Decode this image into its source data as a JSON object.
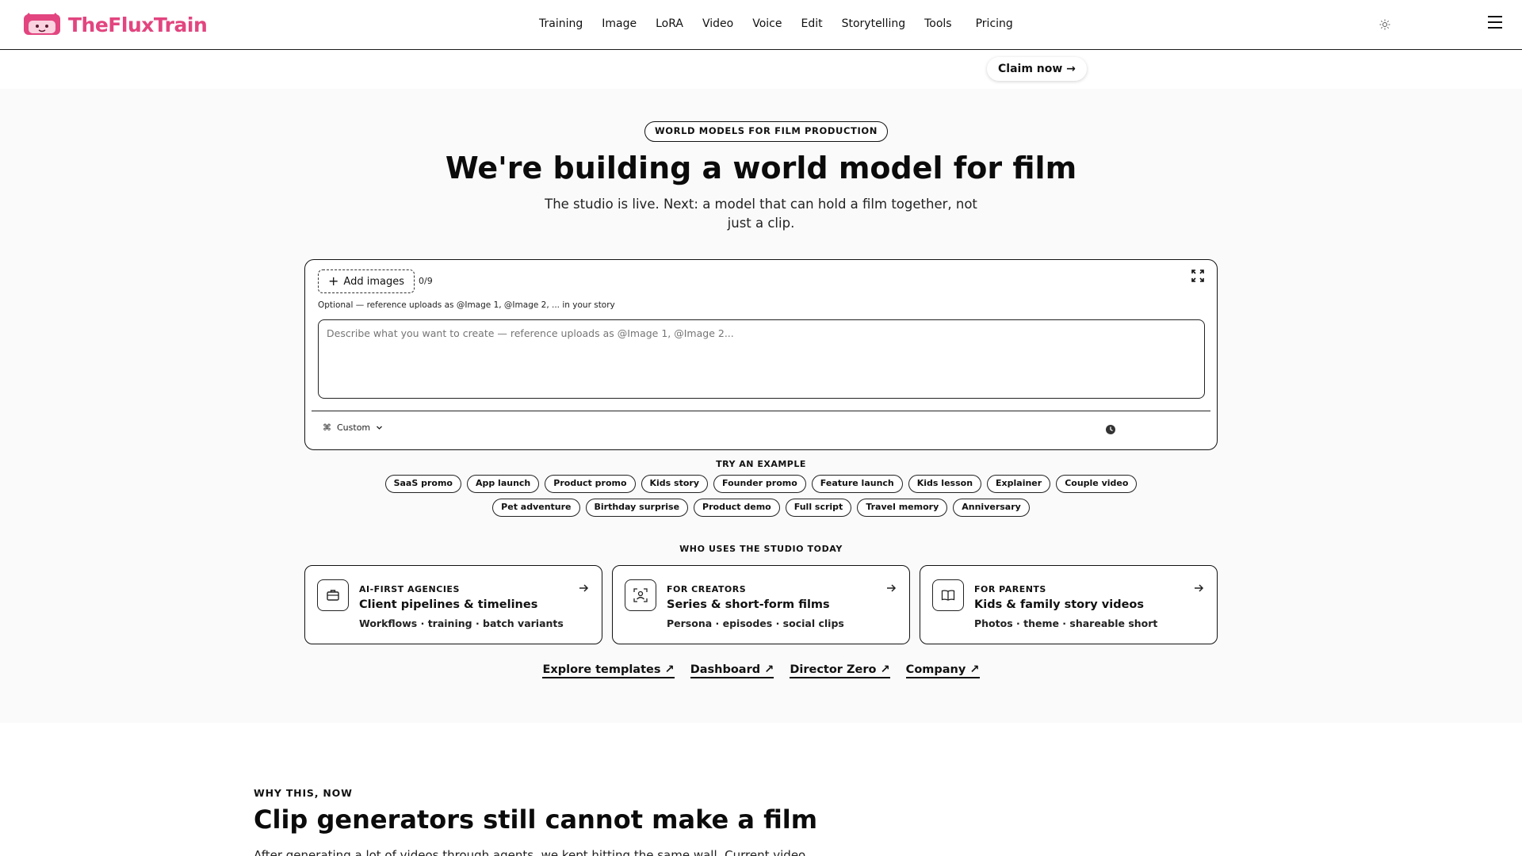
{
  "header": {
    "brand": "TheFluxTrain",
    "nav": [
      "Training",
      "Image",
      "LoRA",
      "Video",
      "Voice",
      "Edit",
      "Storytelling",
      "Tools",
      "Pricing"
    ],
    "theme_icon": "sun-icon",
    "menu_icon": "hamburger-icon"
  },
  "banner": {
    "claim_label": "Claim now →"
  },
  "hero": {
    "eyebrow": "WORLD MODELS FOR FILM PRODUCTION",
    "title": "We're building a world model for film",
    "subtitle": "The studio is live. Next: a model that can hold a film together, not just a clip."
  },
  "composer": {
    "add_images_label": "Add images",
    "image_count": "0/9",
    "hint": "Optional — reference uploads as @Image 1, @Image 2, ... in your story",
    "prompt_placeholder": "Describe what you want to create — reference uploads as @Image 1, @Image 2...",
    "prompt_value": "",
    "mode_label": "Custom",
    "expand_icon": "expand-icon",
    "history_icon": "clock-icon"
  },
  "examples": {
    "label": "TRY AN EXAMPLE",
    "row1": [
      "SaaS promo",
      "App launch",
      "Product promo",
      "Kids story",
      "Founder promo",
      "Feature launch",
      "Kids lesson",
      "Explainer",
      "Couple video"
    ],
    "row2": [
      "Pet adventure",
      "Birthday surprise",
      "Product demo",
      "Full script",
      "Travel memory",
      "Anniversary"
    ]
  },
  "audience": {
    "label": "WHO USES THE STUDIO TODAY",
    "cards": [
      {
        "eyebrow": "AI-FIRST AGENCIES",
        "title": "Client pipelines & timelines",
        "meta": "Workflows · training · batch variants",
        "icon": "briefcase-icon"
      },
      {
        "eyebrow": "FOR CREATORS",
        "title": "Series & short-form films",
        "meta": "Persona · episodes · social clips",
        "icon": "person-focus-icon"
      },
      {
        "eyebrow": "FOR PARENTS",
        "title": "Kids & family story videos",
        "meta": "Photos · theme · shareable short",
        "icon": "open-book-icon"
      }
    ]
  },
  "links": [
    "Explore templates ↗",
    "Dashboard ↗",
    "Director Zero ↗",
    "Company ↗"
  ],
  "why": {
    "label": "WHY THIS, NOW",
    "title": "Clip generators still cannot make a film",
    "body": "After generating a lot of videos through agents, we kept hitting the same wall. Current video"
  }
}
